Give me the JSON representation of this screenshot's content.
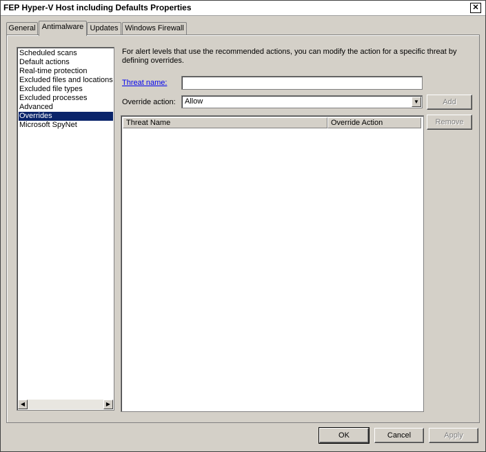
{
  "window": {
    "title": "FEP Hyper-V Host including Defaults Properties",
    "close_glyph": "✕"
  },
  "tabs": [
    {
      "label": "General",
      "active": false
    },
    {
      "label": "Antimalware",
      "active": true
    },
    {
      "label": "Updates",
      "active": false
    },
    {
      "label": "Windows Firewall",
      "active": false
    }
  ],
  "sidebar": {
    "items": [
      {
        "label": "Scheduled scans",
        "selected": false
      },
      {
        "label": "Default actions",
        "selected": false
      },
      {
        "label": "Real-time protection",
        "selected": false
      },
      {
        "label": "Excluded files and locations",
        "selected": false
      },
      {
        "label": "Excluded file types",
        "selected": false
      },
      {
        "label": "Excluded processes",
        "selected": false
      },
      {
        "label": "Advanced",
        "selected": false
      },
      {
        "label": "Overrides",
        "selected": true
      },
      {
        "label": "Microsoft SpyNet",
        "selected": false
      }
    ],
    "scroll_left_glyph": "◀",
    "scroll_right_glyph": "▶"
  },
  "overrides": {
    "description": "For alert levels that use the recommended actions, you can modify the action for a specific threat by defining overrides.",
    "threat_name_label": "Threat name:",
    "threat_name_value": "",
    "override_action_label": "Override action:",
    "override_action_value": "Allow",
    "dropdown_glyph": "▼",
    "add_label": "Add",
    "remove_label": "Remove",
    "table": {
      "columns": [
        "Threat Name",
        "Override Action"
      ],
      "rows": []
    }
  },
  "footer": {
    "ok_label": "OK",
    "cancel_label": "Cancel",
    "apply_label": "Apply"
  }
}
